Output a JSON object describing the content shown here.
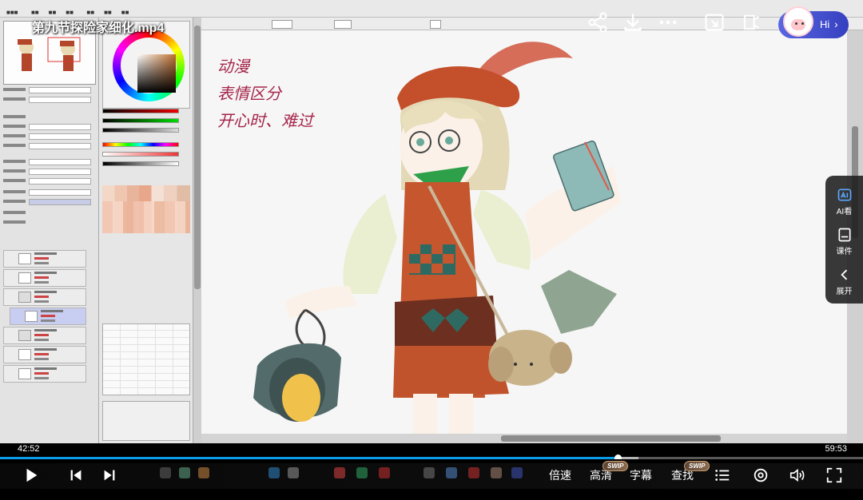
{
  "video": {
    "title": "第九节探险家细化.mp4",
    "current_time": "42:52",
    "duration": "59:53",
    "progress": 0.716,
    "buffered": 0.74
  },
  "top_actions": {
    "share_icon": "share-icon",
    "download_icon": "download-icon",
    "more_icon": "more-icon",
    "pip_icon": "picture-in-picture-icon",
    "cast_icon": "cast-icon",
    "assistant_label": "Hi"
  },
  "side_panel": {
    "items": [
      {
        "label": "AI看",
        "icon": "ai-view-icon"
      },
      {
        "label": "课件",
        "icon": "courseware-icon"
      },
      {
        "label": "展开",
        "icon": "chevron-left-icon"
      }
    ]
  },
  "controls": {
    "speed_label": "倍速",
    "quality_label": "高清",
    "subtitle_label": "字幕",
    "search_label": "查找",
    "swip_badge": "SWIP",
    "swip_badge_2": "SWIP"
  },
  "artwork": {
    "handwriting_lines": [
      "动漫",
      "表情区分",
      "开心时、难过"
    ]
  },
  "colors": {
    "progress_fill": "#0a9ce8",
    "assistant_pill": "#4a55d8",
    "side_panel_bg": "#1e1e1e"
  }
}
